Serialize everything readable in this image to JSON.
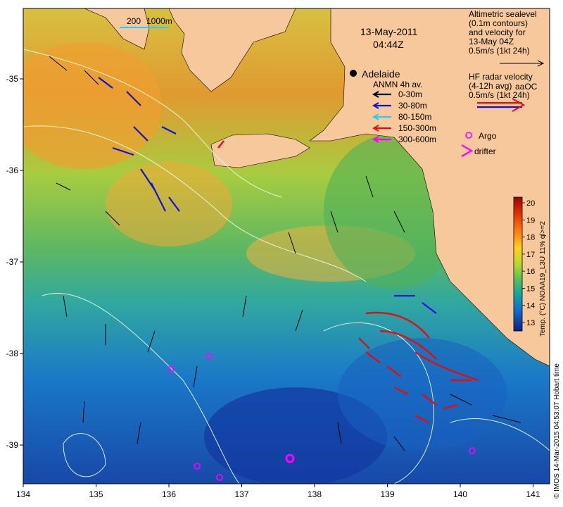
{
  "header": {
    "date": "13-May-2011",
    "time": "04:44Z"
  },
  "scale_bar": {
    "label_1": "200",
    "label_2": "1000m"
  },
  "places": {
    "adelaide": "Adelaide"
  },
  "legend": {
    "alt_title_lines": [
      "Altimetric sealevel",
      "(0.1m contours)",
      "and velocity for",
      "13-May 04Z",
      "0.5m/s (1kt 24h)"
    ],
    "hf_title_lines": [
      "HF radar velocity",
      "(4-12h avg) ",
      "0.5m/s (1kt 24h)"
    ],
    "hf_code": "aaOC",
    "anmn_title": "ANMN 4h av.",
    "anmn_items": [
      {
        "label": "0-30m",
        "color": "#000000"
      },
      {
        "label": "30-80m",
        "color": "#1010e0"
      },
      {
        "label": "80-150m",
        "color": "#20d0ff"
      },
      {
        "label": "150-300m",
        "color": "#e01010"
      },
      {
        "label": "300-600m",
        "color": "#ff00ff"
      }
    ],
    "argo": "Argo",
    "drifter": "drifter"
  },
  "colorbar": {
    "ticks": [
      "20",
      "19",
      "18",
      "17",
      "16",
      "15",
      "14",
      "13"
    ],
    "label": "Temp. (°C) NOAA19_L3U 11% ql>=2",
    "colors": [
      "#a00000",
      "#e03000",
      "#ff7a10",
      "#ffaa20",
      "#f0e020",
      "#b8d830",
      "#70c850",
      "#30b070",
      "#10a0a0",
      "#1070d0",
      "#1040a8",
      "#102080"
    ]
  },
  "axes": {
    "x_ticks": [
      "134",
      "135",
      "136",
      "137",
      "138",
      "139",
      "140",
      "141"
    ],
    "y_ticks": [
      "-35",
      "-36",
      "-37",
      "-38",
      "-39"
    ]
  },
  "credit": "© IMOS 14-Mar-2015 04:53:07 Hobart time",
  "colors": {
    "land": "#f7c89b",
    "argo": "#ff00ff"
  }
}
